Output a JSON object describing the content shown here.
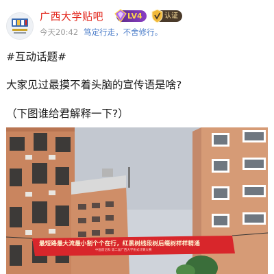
{
  "header": {
    "forum_name": "广西大学贴吧",
    "level_badge": "LV4",
    "verify_badge": "认证",
    "timestamp": "今天20:42",
    "motto": "笃定行走，不舍修行。",
    "avatar_icon": "university-seal-icon"
  },
  "post": {
    "hashtag": "#互动话题#",
    "question": "大家见过最摸不着头脑的宣传语是啥?",
    "prompt": "（下图谁给君解释一下?）"
  },
  "photo": {
    "banner_text": "最短路最大流最小割个个在行，红黑树线段树后缀树样样精通",
    "banner_subtext": "中国前沿科 第二届广西大学形式计算大赛"
  },
  "colors": {
    "forum_red": "#e2241a",
    "motto_blue": "#4a7cc9",
    "banner_red": "#d8262b"
  }
}
